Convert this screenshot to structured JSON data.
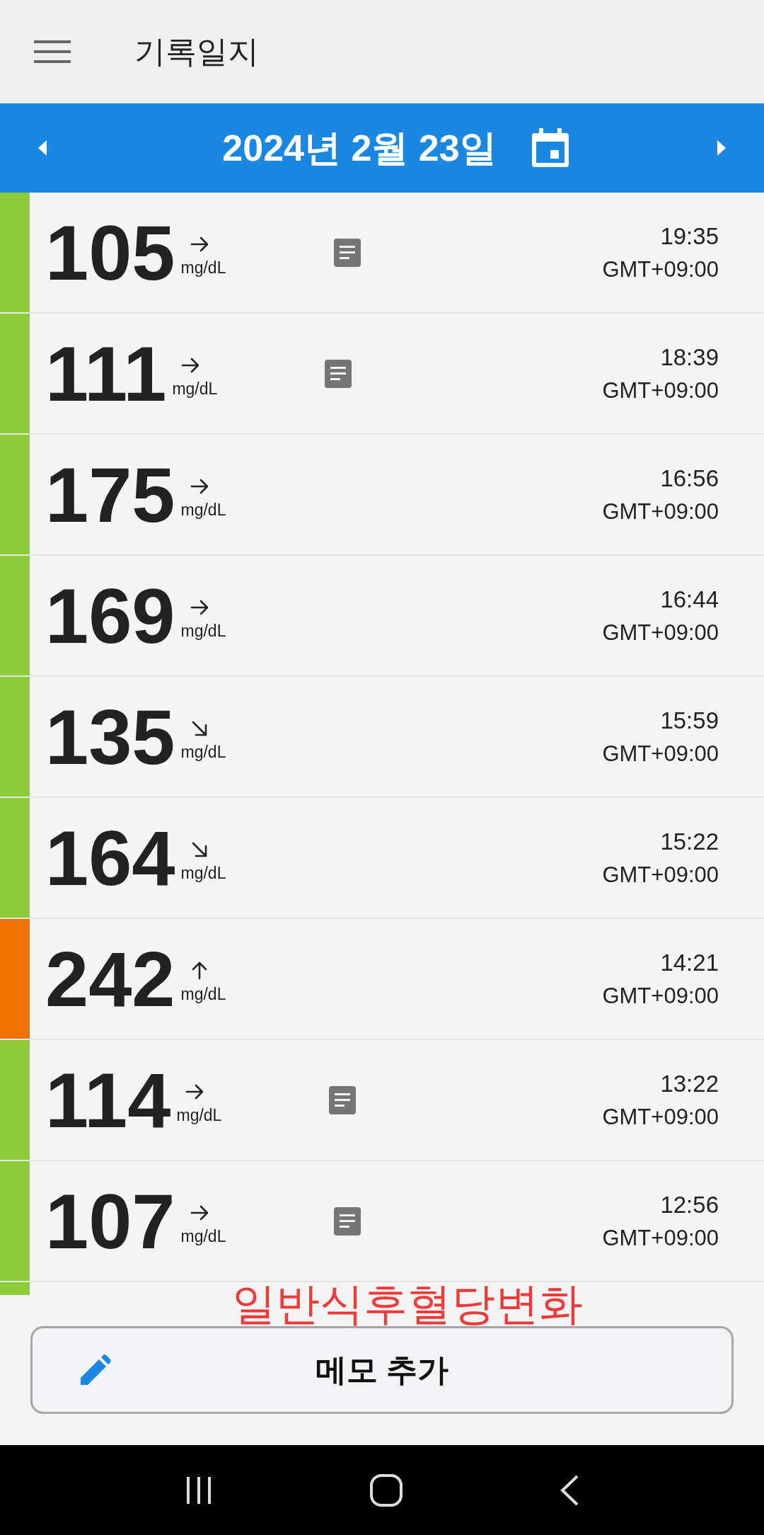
{
  "app_bar": {
    "title": "기록일지"
  },
  "date_bar": {
    "date": "2024년 2월 23일"
  },
  "readings": [
    {
      "value": "105",
      "unit": "mg/dL",
      "kind": "flat",
      "memo": true,
      "time": "19:35",
      "timezone": "GMT+09:00",
      "color": "#8dcb3a"
    },
    {
      "value": "111",
      "unit": "mg/dL",
      "kind": "flat",
      "memo": true,
      "time": "18:39",
      "timezone": "GMT+09:00",
      "color": "#8dcb3a"
    },
    {
      "value": "175",
      "unit": "mg/dL",
      "kind": "flat",
      "memo": false,
      "time": "16:56",
      "timezone": "GMT+09:00",
      "color": "#8dcb3a"
    },
    {
      "value": "169",
      "unit": "mg/dL",
      "kind": "flat",
      "memo": false,
      "time": "16:44",
      "timezone": "GMT+09:00",
      "color": "#8dcb3a"
    },
    {
      "value": "135",
      "unit": "mg/dL",
      "kind": "down",
      "memo": false,
      "time": "15:59",
      "timezone": "GMT+09:00",
      "color": "#8dcb3a"
    },
    {
      "value": "164",
      "unit": "mg/dL",
      "kind": "down",
      "memo": false,
      "time": "15:22",
      "timezone": "GMT+09:00",
      "color": "#8dcb3a"
    },
    {
      "value": "242",
      "unit": "mg/dL",
      "kind": "up",
      "memo": false,
      "time": "14:21",
      "timezone": "GMT+09:00",
      "color": "#f07000"
    },
    {
      "value": "114",
      "unit": "mg/dL",
      "kind": "flat",
      "memo": true,
      "time": "13:22",
      "timezone": "GMT+09:00",
      "color": "#8dcb3a"
    },
    {
      "value": "107",
      "unit": "mg/dL",
      "kind": "flat",
      "memo": true,
      "time": "12:56",
      "timezone": "GMT+09:00",
      "color": "#8dcb3a"
    }
  ],
  "next_row": {
    "color": "#8dcb3a"
  },
  "annotation": {
    "text": "일반식후혈당변화"
  },
  "add_memo_button": {
    "label": "메모 추가"
  }
}
